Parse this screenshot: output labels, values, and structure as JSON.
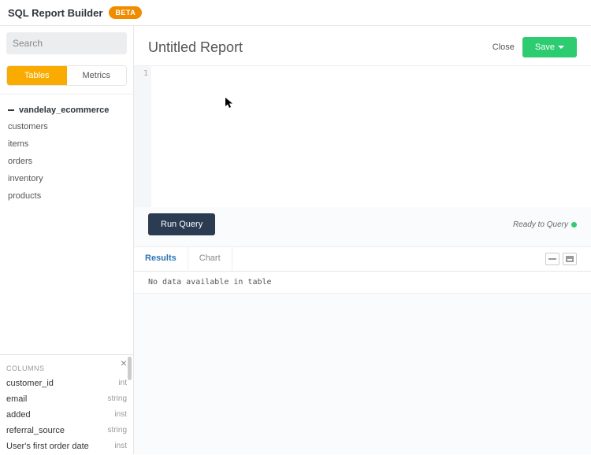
{
  "header": {
    "title": "SQL Report Builder",
    "badge": "BETA"
  },
  "sidebar": {
    "search_placeholder": "Search",
    "tabs": {
      "tables": "Tables",
      "metrics": "Metrics"
    },
    "database": "vandelay_ecommerce",
    "tables": [
      "customers",
      "items",
      "orders",
      "inventory",
      "products"
    ]
  },
  "columns_panel": {
    "header": "COLUMNS",
    "rows": [
      {
        "name": "customer_id",
        "type": "int"
      },
      {
        "name": "email",
        "type": "string"
      },
      {
        "name": "added",
        "type": "inst"
      },
      {
        "name": "referral_source",
        "type": "string"
      },
      {
        "name": "User's first order date",
        "type": "inst"
      }
    ]
  },
  "report": {
    "title": "Untitled Report",
    "close": "Close",
    "save": "Save"
  },
  "editor": {
    "line1": "1"
  },
  "run": {
    "label": "Run Query",
    "status": "Ready to Query"
  },
  "results": {
    "tabs": {
      "results": "Results",
      "chart": "Chart"
    },
    "empty": "No data available in table"
  }
}
